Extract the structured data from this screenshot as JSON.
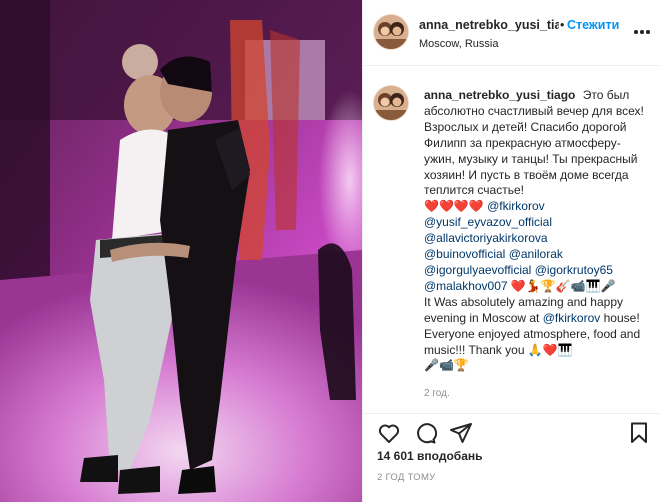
{
  "post": {
    "username": "anna_netrebko_yusi_tiago",
    "username_header": "anna_netrebko_yusi_tiag",
    "follow_label": "Стежити",
    "separator": "•",
    "location": "Moscow, Russia"
  },
  "caption": {
    "intro": "Это был абсолютно счастливый вечер для всех! Взрослых и детей! Спасибо дорогой Филипп за прекрасную атмосферу- ужин, музыку и танцы! Ты прекрасный хозяин! И пусть в твоём доме всегда теплится счастье!",
    "hearts": "❤️❤️❤️❤️",
    "mentions": [
      "@fkirkorov",
      "@yusif_eyvazov_official",
      "@allavictoriyakirkorova",
      "@buinovofficial",
      "@anilorak",
      "@igorgulyaevofficial",
      "@igorkrutoy65",
      "@malakhov007"
    ],
    "emoji_line_1": "❤️💃🏆🎸📹🎹🎤",
    "english_1": "It Was absolutely amazing and happy evening in Moscow at",
    "english_mention": "@fkirkorov",
    "english_2": "house! Everyone enjoyed atmosphere, food and music!!! Thank you",
    "emoji_line_2": "🙏❤️🎹",
    "emoji_line_3": "🎤📹🏆",
    "time": "2 год."
  },
  "actions": {
    "icons": [
      "heart-icon",
      "comment-icon",
      "share-icon",
      "bookmark-icon"
    ]
  },
  "stats": {
    "likes": "14 601 вподобань",
    "posted_ago": "2 ГОД ТОМУ"
  },
  "colors": {
    "link": "#00376b",
    "follow": "#0095f6",
    "muted": "#8e8e8e",
    "media_tint": "#c63ec0"
  }
}
